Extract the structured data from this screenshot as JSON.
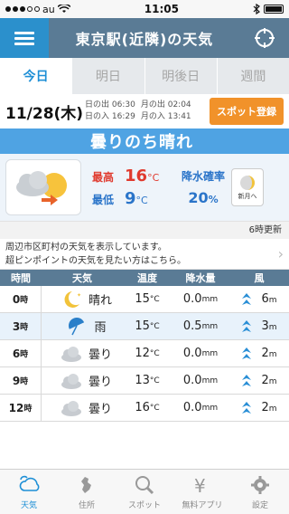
{
  "status_bar": {
    "carrier": "au",
    "time": "11:05"
  },
  "header": {
    "title": "東京駅(近隣)の天気"
  },
  "tabs": [
    {
      "label": "今日"
    },
    {
      "label": "明日"
    },
    {
      "label": "明後日"
    },
    {
      "label": "週間"
    }
  ],
  "date": "11/28(木)",
  "sun": {
    "sunrise_label": "日の出",
    "sunrise": "06:30",
    "moonrise_label": "月の出",
    "moonrise": "02:04",
    "sunset_label": "日の入",
    "sunset": "16:29",
    "moonset_label": "月の入",
    "moonset": "13:41"
  },
  "spot_button": "スポット登録",
  "summary": {
    "weather": "曇りのち晴れ",
    "high_label": "最高",
    "high": "16",
    "high_unit": "°C",
    "low_label": "最低",
    "low": "9",
    "low_unit": "°C",
    "precip_label": "降水確率",
    "precip": "20",
    "precip_unit": "%",
    "moon_label": "新月へ"
  },
  "update_text": "6時更新",
  "notice": {
    "line1": "周辺市区町村の天気を表示しています。",
    "line2": "超ピンポイントの天気を見たい方はこちら。"
  },
  "table": {
    "headers": {
      "time": "時間",
      "weather": "天気",
      "temp": "温度",
      "rain": "降水量",
      "wind": "風"
    },
    "rows": [
      {
        "hour": "0",
        "hour_unit": "時",
        "weather": "晴れ",
        "icon": "moon-icon",
        "temp": "15",
        "temp_unit": "°C",
        "rain": "0.0",
        "rain_unit": "mm",
        "wind": "6",
        "wind_unit": "m"
      },
      {
        "hour": "3",
        "hour_unit": "時",
        "weather": "雨",
        "icon": "umbrella-icon",
        "temp": "15",
        "temp_unit": "°C",
        "rain": "0.5",
        "rain_unit": "mm",
        "wind": "3",
        "wind_unit": "m"
      },
      {
        "hour": "6",
        "hour_unit": "時",
        "weather": "曇り",
        "icon": "cloud-icon",
        "temp": "12",
        "temp_unit": "°C",
        "rain": "0.0",
        "rain_unit": "mm",
        "wind": "2",
        "wind_unit": "m"
      },
      {
        "hour": "9",
        "hour_unit": "時",
        "weather": "曇り",
        "icon": "cloud-icon",
        "temp": "13",
        "temp_unit": "°C",
        "rain": "0.0",
        "rain_unit": "mm",
        "wind": "2",
        "wind_unit": "m"
      },
      {
        "hour": "12",
        "hour_unit": "時",
        "weather": "曇り",
        "icon": "cloud-icon",
        "temp": "16",
        "temp_unit": "°C",
        "rain": "0.0",
        "rain_unit": "mm",
        "wind": "2",
        "wind_unit": "m"
      }
    ]
  },
  "tabbar": [
    {
      "label": "天気",
      "icon": "weather-icon"
    },
    {
      "label": "住所",
      "icon": "map-icon"
    },
    {
      "label": "スポット",
      "icon": "search-icon"
    },
    {
      "label": "無料アプリ",
      "icon": "yen-icon"
    },
    {
      "label": "設定",
      "icon": "gear-icon"
    }
  ],
  "colors": {
    "accent": "#1e8fd6",
    "header": "#5a7b95",
    "orange": "#f1922a",
    "high": "#e03a2e",
    "low": "#2a74c9"
  }
}
